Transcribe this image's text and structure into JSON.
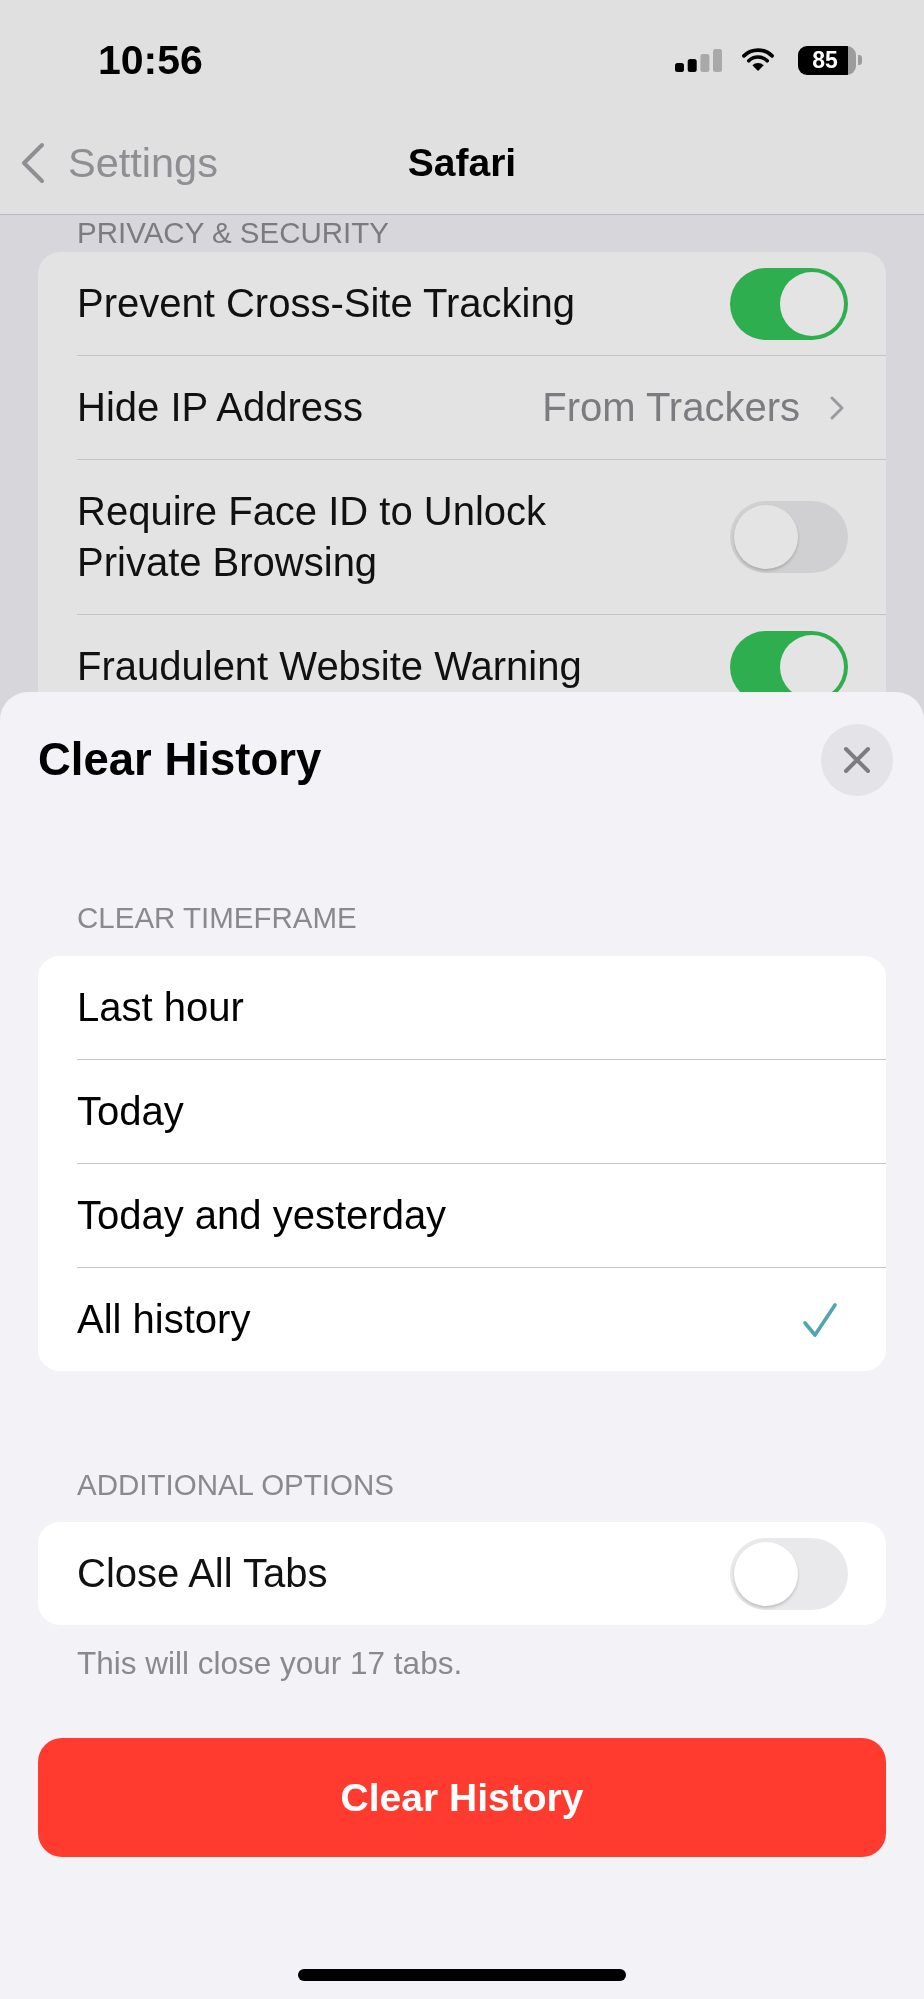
{
  "status_bar": {
    "time": "10:56",
    "battery": "85"
  },
  "nav_bar": {
    "back_label": "Settings",
    "title": "Safari"
  },
  "settings": {
    "section_header": "PRIVACY & SECURITY",
    "rows": [
      {
        "kind": "toggle",
        "label": "Prevent Cross-Site Tracking",
        "on": true
      },
      {
        "kind": "link",
        "label": "Hide IP Address",
        "value": "From Trackers"
      },
      {
        "kind": "toggle",
        "label": "Require Face ID to Unlock Private Browsing",
        "on": false
      },
      {
        "kind": "toggle",
        "label": "Fraudulent Website Warning",
        "on": true
      }
    ]
  },
  "sheet": {
    "title": "Clear History",
    "timeframe": {
      "header": "CLEAR TIMEFRAME",
      "options": [
        {
          "label": "Last hour",
          "selected": false
        },
        {
          "label": "Today",
          "selected": false
        },
        {
          "label": "Today and yesterday",
          "selected": false
        },
        {
          "label": "All history",
          "selected": true
        }
      ]
    },
    "additional": {
      "header": "ADDITIONAL OPTIONS",
      "rows": [
        {
          "kind": "toggle",
          "label": "Close All Tabs",
          "on": false
        }
      ],
      "footer": "This will close your 17 tabs."
    },
    "action": "Clear History"
  }
}
